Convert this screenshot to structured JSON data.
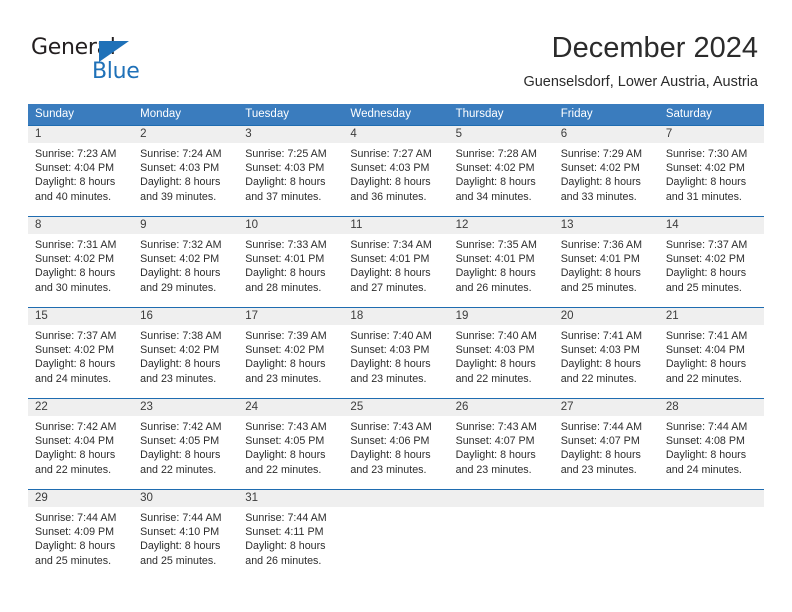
{
  "brand": {
    "name_top": "General",
    "name_bottom": "Blue",
    "triangle_color": "#1f71b8",
    "text_color": "#231f20"
  },
  "header": {
    "title": "December 2024",
    "subtitle": "Guenselsdorf, Lower Austria, Austria"
  },
  "theme": {
    "header_blue": "#3a7cbe",
    "separator_blue": "#1f6cb0",
    "daynum_band": "#efefef",
    "text": "#2d2d2d"
  },
  "weekdays": [
    "Sunday",
    "Monday",
    "Tuesday",
    "Wednesday",
    "Thursday",
    "Friday",
    "Saturday"
  ],
  "weeks": [
    {
      "days": [
        {
          "num": "1",
          "sunrise": "Sunrise: 7:23 AM",
          "sunset": "Sunset: 4:04 PM",
          "daylight1": "Daylight: 8 hours",
          "daylight2": "and 40 minutes."
        },
        {
          "num": "2",
          "sunrise": "Sunrise: 7:24 AM",
          "sunset": "Sunset: 4:03 PM",
          "daylight1": "Daylight: 8 hours",
          "daylight2": "and 39 minutes."
        },
        {
          "num": "3",
          "sunrise": "Sunrise: 7:25 AM",
          "sunset": "Sunset: 4:03 PM",
          "daylight1": "Daylight: 8 hours",
          "daylight2": "and 37 minutes."
        },
        {
          "num": "4",
          "sunrise": "Sunrise: 7:27 AM",
          "sunset": "Sunset: 4:03 PM",
          "daylight1": "Daylight: 8 hours",
          "daylight2": "and 36 minutes."
        },
        {
          "num": "5",
          "sunrise": "Sunrise: 7:28 AM",
          "sunset": "Sunset: 4:02 PM",
          "daylight1": "Daylight: 8 hours",
          "daylight2": "and 34 minutes."
        },
        {
          "num": "6",
          "sunrise": "Sunrise: 7:29 AM",
          "sunset": "Sunset: 4:02 PM",
          "daylight1": "Daylight: 8 hours",
          "daylight2": "and 33 minutes."
        },
        {
          "num": "7",
          "sunrise": "Sunrise: 7:30 AM",
          "sunset": "Sunset: 4:02 PM",
          "daylight1": "Daylight: 8 hours",
          "daylight2": "and 31 minutes."
        }
      ]
    },
    {
      "days": [
        {
          "num": "8",
          "sunrise": "Sunrise: 7:31 AM",
          "sunset": "Sunset: 4:02 PM",
          "daylight1": "Daylight: 8 hours",
          "daylight2": "and 30 minutes."
        },
        {
          "num": "9",
          "sunrise": "Sunrise: 7:32 AM",
          "sunset": "Sunset: 4:02 PM",
          "daylight1": "Daylight: 8 hours",
          "daylight2": "and 29 minutes."
        },
        {
          "num": "10",
          "sunrise": "Sunrise: 7:33 AM",
          "sunset": "Sunset: 4:01 PM",
          "daylight1": "Daylight: 8 hours",
          "daylight2": "and 28 minutes."
        },
        {
          "num": "11",
          "sunrise": "Sunrise: 7:34 AM",
          "sunset": "Sunset: 4:01 PM",
          "daylight1": "Daylight: 8 hours",
          "daylight2": "and 27 minutes."
        },
        {
          "num": "12",
          "sunrise": "Sunrise: 7:35 AM",
          "sunset": "Sunset: 4:01 PM",
          "daylight1": "Daylight: 8 hours",
          "daylight2": "and 26 minutes."
        },
        {
          "num": "13",
          "sunrise": "Sunrise: 7:36 AM",
          "sunset": "Sunset: 4:01 PM",
          "daylight1": "Daylight: 8 hours",
          "daylight2": "and 25 minutes."
        },
        {
          "num": "14",
          "sunrise": "Sunrise: 7:37 AM",
          "sunset": "Sunset: 4:02 PM",
          "daylight1": "Daylight: 8 hours",
          "daylight2": "and 25 minutes."
        }
      ]
    },
    {
      "days": [
        {
          "num": "15",
          "sunrise": "Sunrise: 7:37 AM",
          "sunset": "Sunset: 4:02 PM",
          "daylight1": "Daylight: 8 hours",
          "daylight2": "and 24 minutes."
        },
        {
          "num": "16",
          "sunrise": "Sunrise: 7:38 AM",
          "sunset": "Sunset: 4:02 PM",
          "daylight1": "Daylight: 8 hours",
          "daylight2": "and 23 minutes."
        },
        {
          "num": "17",
          "sunrise": "Sunrise: 7:39 AM",
          "sunset": "Sunset: 4:02 PM",
          "daylight1": "Daylight: 8 hours",
          "daylight2": "and 23 minutes."
        },
        {
          "num": "18",
          "sunrise": "Sunrise: 7:40 AM",
          "sunset": "Sunset: 4:03 PM",
          "daylight1": "Daylight: 8 hours",
          "daylight2": "and 23 minutes."
        },
        {
          "num": "19",
          "sunrise": "Sunrise: 7:40 AM",
          "sunset": "Sunset: 4:03 PM",
          "daylight1": "Daylight: 8 hours",
          "daylight2": "and 22 minutes."
        },
        {
          "num": "20",
          "sunrise": "Sunrise: 7:41 AM",
          "sunset": "Sunset: 4:03 PM",
          "daylight1": "Daylight: 8 hours",
          "daylight2": "and 22 minutes."
        },
        {
          "num": "21",
          "sunrise": "Sunrise: 7:41 AM",
          "sunset": "Sunset: 4:04 PM",
          "daylight1": "Daylight: 8 hours",
          "daylight2": "and 22 minutes."
        }
      ]
    },
    {
      "days": [
        {
          "num": "22",
          "sunrise": "Sunrise: 7:42 AM",
          "sunset": "Sunset: 4:04 PM",
          "daylight1": "Daylight: 8 hours",
          "daylight2": "and 22 minutes."
        },
        {
          "num": "23",
          "sunrise": "Sunrise: 7:42 AM",
          "sunset": "Sunset: 4:05 PM",
          "daylight1": "Daylight: 8 hours",
          "daylight2": "and 22 minutes."
        },
        {
          "num": "24",
          "sunrise": "Sunrise: 7:43 AM",
          "sunset": "Sunset: 4:05 PM",
          "daylight1": "Daylight: 8 hours",
          "daylight2": "and 22 minutes."
        },
        {
          "num": "25",
          "sunrise": "Sunrise: 7:43 AM",
          "sunset": "Sunset: 4:06 PM",
          "daylight1": "Daylight: 8 hours",
          "daylight2": "and 23 minutes."
        },
        {
          "num": "26",
          "sunrise": "Sunrise: 7:43 AM",
          "sunset": "Sunset: 4:07 PM",
          "daylight1": "Daylight: 8 hours",
          "daylight2": "and 23 minutes."
        },
        {
          "num": "27",
          "sunrise": "Sunrise: 7:44 AM",
          "sunset": "Sunset: 4:07 PM",
          "daylight1": "Daylight: 8 hours",
          "daylight2": "and 23 minutes."
        },
        {
          "num": "28",
          "sunrise": "Sunrise: 7:44 AM",
          "sunset": "Sunset: 4:08 PM",
          "daylight1": "Daylight: 8 hours",
          "daylight2": "and 24 minutes."
        }
      ]
    },
    {
      "days": [
        {
          "num": "29",
          "sunrise": "Sunrise: 7:44 AM",
          "sunset": "Sunset: 4:09 PM",
          "daylight1": "Daylight: 8 hours",
          "daylight2": "and 25 minutes."
        },
        {
          "num": "30",
          "sunrise": "Sunrise: 7:44 AM",
          "sunset": "Sunset: 4:10 PM",
          "daylight1": "Daylight: 8 hours",
          "daylight2": "and 25 minutes."
        },
        {
          "num": "31",
          "sunrise": "Sunrise: 7:44 AM",
          "sunset": "Sunset: 4:11 PM",
          "daylight1": "Daylight: 8 hours",
          "daylight2": "and 26 minutes."
        },
        {
          "num": "",
          "sunrise": "",
          "sunset": "",
          "daylight1": "",
          "daylight2": ""
        },
        {
          "num": "",
          "sunrise": "",
          "sunset": "",
          "daylight1": "",
          "daylight2": ""
        },
        {
          "num": "",
          "sunrise": "",
          "sunset": "",
          "daylight1": "",
          "daylight2": ""
        },
        {
          "num": "",
          "sunrise": "",
          "sunset": "",
          "daylight1": "",
          "daylight2": ""
        }
      ]
    }
  ]
}
